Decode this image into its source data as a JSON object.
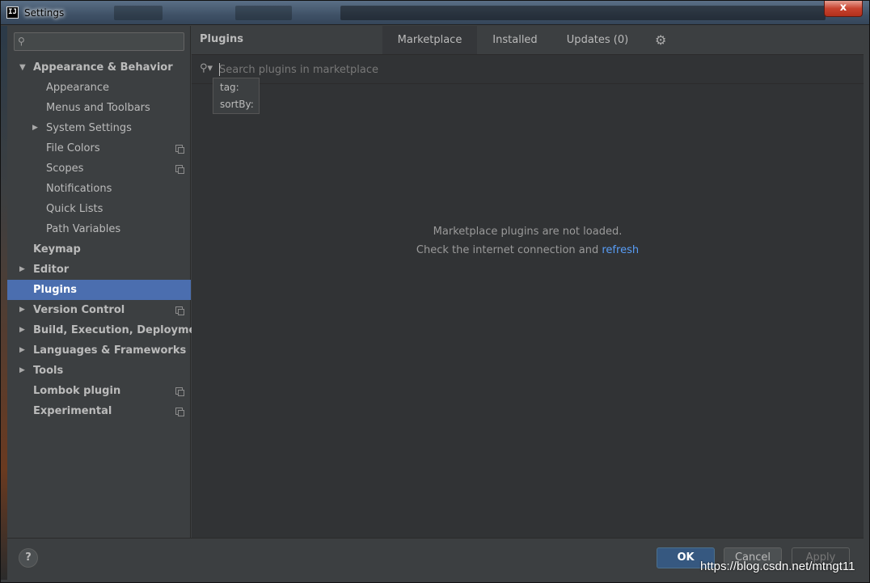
{
  "window": {
    "title": "Settings",
    "close_label": "x",
    "app_icon": "IJ"
  },
  "sidebar": {
    "search_placeholder": "",
    "items": [
      {
        "label": "Appearance & Behavior",
        "bold": true,
        "expander": "expanded",
        "indent": 0
      },
      {
        "label": "Appearance",
        "indent": 1
      },
      {
        "label": "Menus and Toolbars",
        "indent": 1
      },
      {
        "label": "System Settings",
        "indent": 1,
        "expander": "collapsed"
      },
      {
        "label": "File Colors",
        "indent": 1,
        "copy": true
      },
      {
        "label": "Scopes",
        "indent": 1,
        "copy": true
      },
      {
        "label": "Notifications",
        "indent": 1
      },
      {
        "label": "Quick Lists",
        "indent": 1
      },
      {
        "label": "Path Variables",
        "indent": 1
      },
      {
        "label": "Keymap",
        "bold": true,
        "indent": 0
      },
      {
        "label": "Editor",
        "bold": true,
        "expander": "collapsed",
        "indent": 0
      },
      {
        "label": "Plugins",
        "bold": true,
        "indent": 0,
        "selected": true
      },
      {
        "label": "Version Control",
        "bold": true,
        "expander": "collapsed",
        "indent": 0,
        "copy": true
      },
      {
        "label": "Build, Execution, Deployment",
        "bold": true,
        "expander": "collapsed",
        "indent": 0
      },
      {
        "label": "Languages & Frameworks",
        "bold": true,
        "expander": "collapsed",
        "indent": 0
      },
      {
        "label": "Tools",
        "bold": true,
        "expander": "collapsed",
        "indent": 0
      },
      {
        "label": "Lombok plugin",
        "bold": true,
        "indent": 0,
        "copy": true
      },
      {
        "label": "Experimental",
        "bold": true,
        "indent": 0,
        "copy": true
      }
    ]
  },
  "main": {
    "title": "Plugins",
    "tabs": [
      {
        "label": "Marketplace",
        "active": true
      },
      {
        "label": "Installed"
      },
      {
        "label": "Updates (0)"
      }
    ],
    "search_placeholder": "Search plugins in marketplace",
    "popup_items": [
      "tag:",
      "sortBy:"
    ],
    "message_line1": "Marketplace plugins are not loaded.",
    "message_line2_prefix": "Check the internet connection and ",
    "message_link": "refresh"
  },
  "footer": {
    "help_label": "?",
    "ok_label": "OK",
    "cancel_label": "Cancel",
    "apply_label": "Apply"
  },
  "watermark": "https://blog.csdn.net/mtngt11",
  "colors": {
    "selection": "#4b6eaf",
    "link": "#589df6",
    "ok_button": "#365880"
  }
}
